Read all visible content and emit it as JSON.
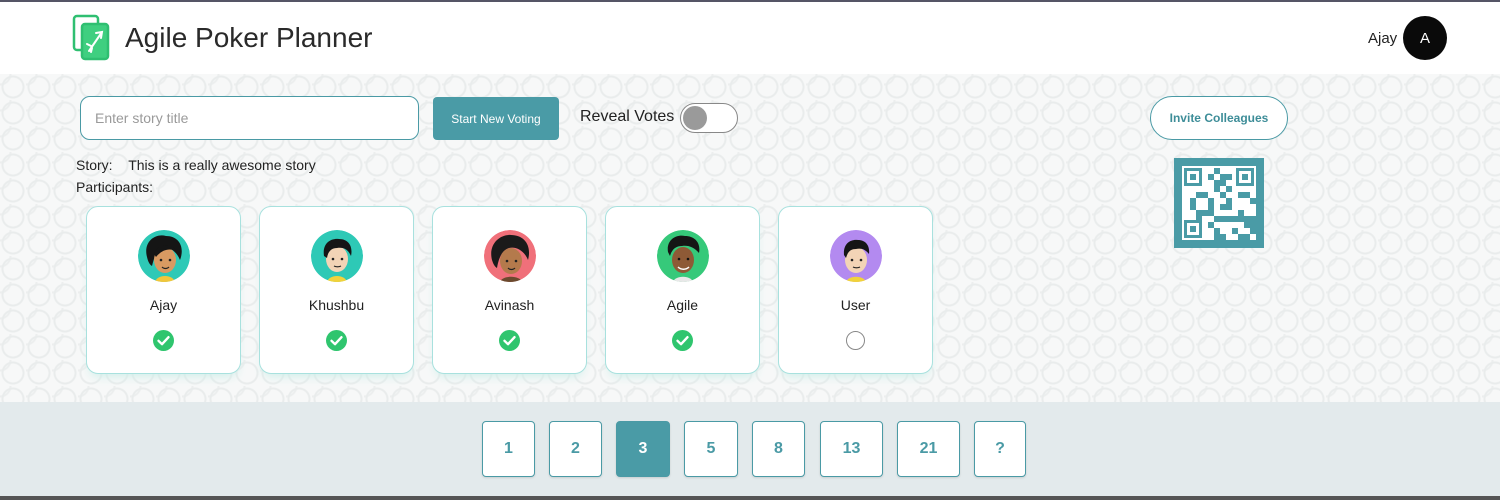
{
  "header": {
    "title": "Agile Poker Planner",
    "user_name": "Ajay",
    "avatar_initial": "A"
  },
  "controls": {
    "story_placeholder": "Enter story title",
    "start_button": "Start New Voting",
    "reveal_label": "Reveal Votes",
    "reveal_enabled": false,
    "invite_button": "Invite Colleagues"
  },
  "story": {
    "label": "Story:",
    "title": "This is a really awesome story"
  },
  "participants": {
    "label": "Participants:",
    "items": [
      {
        "name": "Ajay",
        "voted": true,
        "avatar_color": "#2ec9b6"
      },
      {
        "name": "Khushbu",
        "voted": true,
        "avatar_color": "#2ec9b6"
      },
      {
        "name": "Avinash",
        "voted": true,
        "avatar_color": "#f0707a"
      },
      {
        "name": "Agile",
        "voted": true,
        "avatar_color": "#36c97a"
      },
      {
        "name": "User",
        "voted": false,
        "avatar_color": "#b38af0"
      }
    ]
  },
  "cards": {
    "values": [
      "1",
      "2",
      "3",
      "5",
      "8",
      "13",
      "21",
      "?"
    ],
    "selected": "3"
  },
  "colors": {
    "accent": "#4a9ba6",
    "check": "#2fc56e"
  }
}
